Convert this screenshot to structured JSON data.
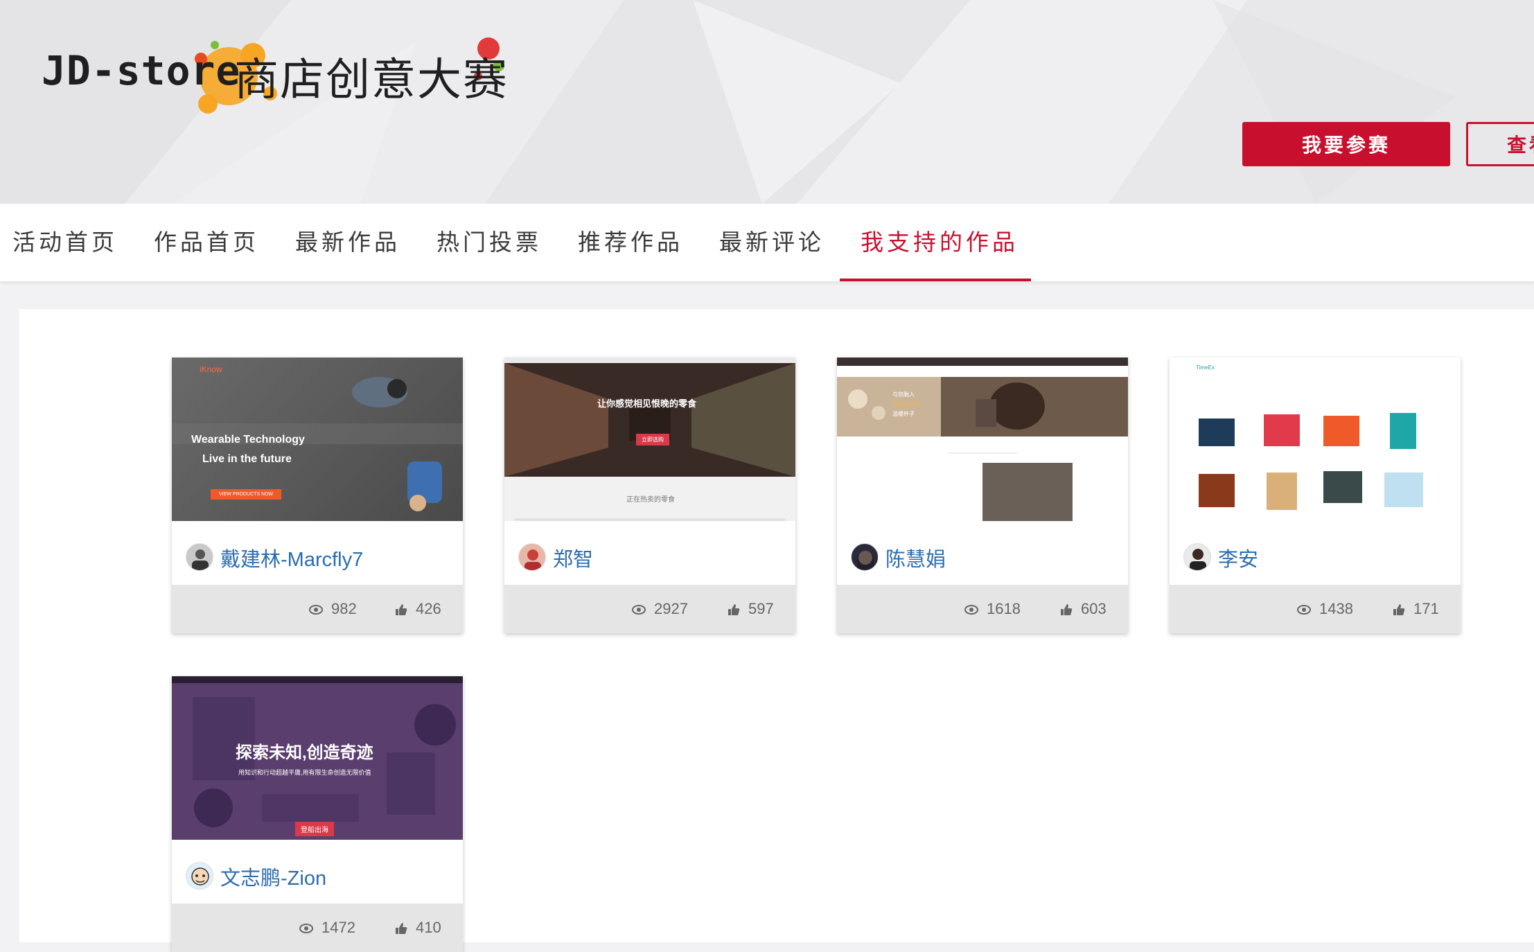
{
  "header": {
    "logo_en": "JD-store",
    "logo_cn": "商店创意大赛",
    "join_button": "我要参赛",
    "view_button": "查看"
  },
  "nav": {
    "items": [
      "活动首页",
      "作品首页",
      "最新作品",
      "热门投票",
      "推荐作品",
      "最新评论",
      "我支持的作品"
    ],
    "active_index": 6
  },
  "cards": [
    {
      "author": "戴建林-Marcfly7",
      "views": "982",
      "likes": "426",
      "thumb": {
        "brand": "iKnow",
        "title1": "Wearable Technology",
        "title2": "Live in the future",
        "cta": "VIEW PRODUCTS NOW"
      }
    },
    {
      "author": "郑智",
      "views": "2927",
      "likes": "597",
      "thumb": {
        "title": "让你感觉相见恨晚的零食",
        "cta": "立即选购",
        "footer": "正在热卖的零食"
      }
    },
    {
      "author": "陈慧娟",
      "views": "1618",
      "likes": "603",
      "thumb": {
        "line1": "与您融入",
        "line2": "创意设计的",
        "line3": "温暖杯子"
      }
    },
    {
      "author": "李安",
      "views": "1438",
      "likes": "171",
      "thumb": {
        "brand": "TimeEx"
      }
    },
    {
      "author": "文志鹏-Zion",
      "views": "1472",
      "likes": "410",
      "thumb": {
        "title": "探索未知,创造奇迹",
        "sub": "用知识和行动超越平庸,用有限生命创造无限价值",
        "cta": "登船出海"
      }
    }
  ],
  "colors": {
    "accent": "#c8102e",
    "link": "#2b6cb0"
  }
}
